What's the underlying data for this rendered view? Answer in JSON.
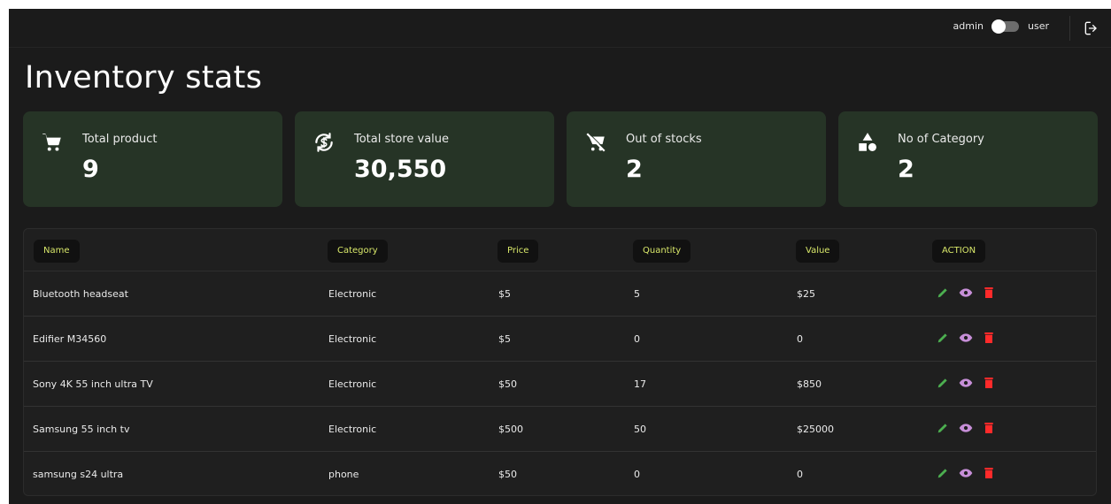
{
  "header": {
    "role_left": "admin",
    "role_right": "user",
    "toggle_icon": "toggle-switch",
    "logout_icon": "logout-icon"
  },
  "page": {
    "title": "Inventory stats"
  },
  "cards": [
    {
      "label": "Total product",
      "value": "9",
      "icon": "cart-icon"
    },
    {
      "label": "Total store value",
      "value": "30,550",
      "icon": "currency-exchange-icon"
    },
    {
      "label": "Out of stocks",
      "value": "2",
      "icon": "remove-cart-icon"
    },
    {
      "label": "No of Category",
      "value": "2",
      "icon": "shapes-icon"
    }
  ],
  "table": {
    "headers": [
      "Name",
      "Category",
      "Price",
      "Quantity",
      "Value",
      "ACTION"
    ],
    "rows": [
      {
        "name": "Bluetooth headseat",
        "category": "Electronic",
        "price": "$5",
        "quantity": "5",
        "value": "$25"
      },
      {
        "name": "Edifier M34560",
        "category": "Electronic",
        "price": "$5",
        "quantity": "0",
        "value": "0"
      },
      {
        "name": "Sony 4K 55 inch ultra TV",
        "category": "Electronic",
        "price": "$50",
        "quantity": "17",
        "value": "$850"
      },
      {
        "name": "Samsung 55 inch tv",
        "category": "Electronic",
        "price": "$500",
        "quantity": "50",
        "value": "$25000"
      },
      {
        "name": "samsung s24 ultra",
        "category": "phone",
        "price": "$50",
        "quantity": "0",
        "value": "0"
      }
    ],
    "action_icons": [
      "edit-icon",
      "view-icon",
      "delete-icon"
    ]
  },
  "colors": {
    "background": "#1b1b1b",
    "card": "#263426",
    "header_pill_text": "#d9e86a",
    "edit": "#4caf50",
    "view": "#c78fd8",
    "delete": "#ff2a2a"
  }
}
